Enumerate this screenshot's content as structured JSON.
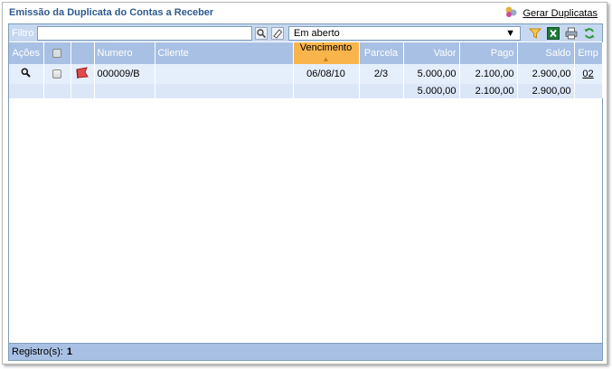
{
  "page": {
    "title": "Emissão da Duplicata do Contas a Receber",
    "gerar_label": "Gerar Duplicatas"
  },
  "filter": {
    "label": "Filtro",
    "value": "",
    "status_selected": "Em aberto"
  },
  "columns": {
    "acoes": "Ações",
    "numero": "Numero",
    "cliente": "Cliente",
    "vencimento": "Vencimento",
    "parcela": "Parcela",
    "valor": "Valor",
    "pago": "Pago",
    "saldo": "Saldo",
    "emp": "Emp"
  },
  "rows": [
    {
      "numero": "000009/B",
      "cliente": "",
      "vencimento": "06/08/10",
      "parcela": "2/3",
      "valor": "5.000,00",
      "pago": "2.100,00",
      "saldo": "2.900,00",
      "emp": "02"
    }
  ],
  "totals": {
    "valor": "5.000,00",
    "pago": "2.100,00",
    "saldo": "2.900,00"
  },
  "footer": {
    "label": "Registro(s):",
    "count": "1"
  },
  "colors": {
    "header_bg": "#a7c0e3",
    "active_sort": "#f9b54c",
    "title": "#2e5a8c"
  }
}
